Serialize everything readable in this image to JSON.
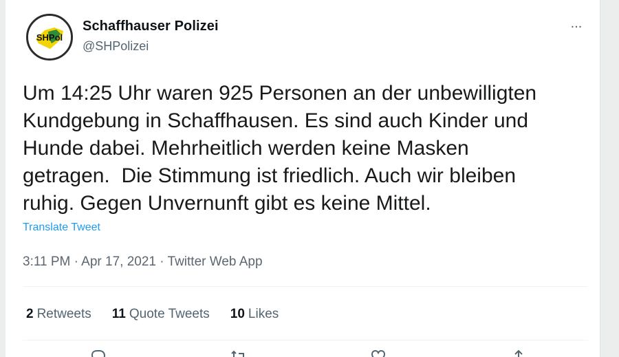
{
  "tweet": {
    "author": {
      "display_name": "Schaffhauser Polizei",
      "handle": "@SHPolizei",
      "avatar_text": "SHPol"
    },
    "more_icon": "...",
    "text": "Um 14:25 Uhr waren 925 Personen an der unbewilligten\nKundgebung in Schaffhausen. Es sind auch Kinder und\nHunde dabei. Mehrheitlich werden keine Masken\ngetragen.  Die Stimmung ist friedlich. Auch wir bleiben\nruhig. Gegen Unvernunft gibt es keine Mittel.",
    "translate_label": "Translate Tweet",
    "timestamp": "3:11 PM · Apr 17, 2021 · Twitter Web App",
    "stats": [
      {
        "count": "2",
        "label": "Retweets"
      },
      {
        "count": "11",
        "label": "Quote Tweets"
      },
      {
        "count": "10",
        "label": "Likes"
      }
    ],
    "actions": [
      "reply-icon",
      "retweet-icon",
      "like-icon",
      "share-icon"
    ]
  },
  "colors": {
    "link": "#1d9bf0",
    "muted": "#536471",
    "avatar_yellow": "#f3d300",
    "avatar_green": "#2f8d3a"
  }
}
